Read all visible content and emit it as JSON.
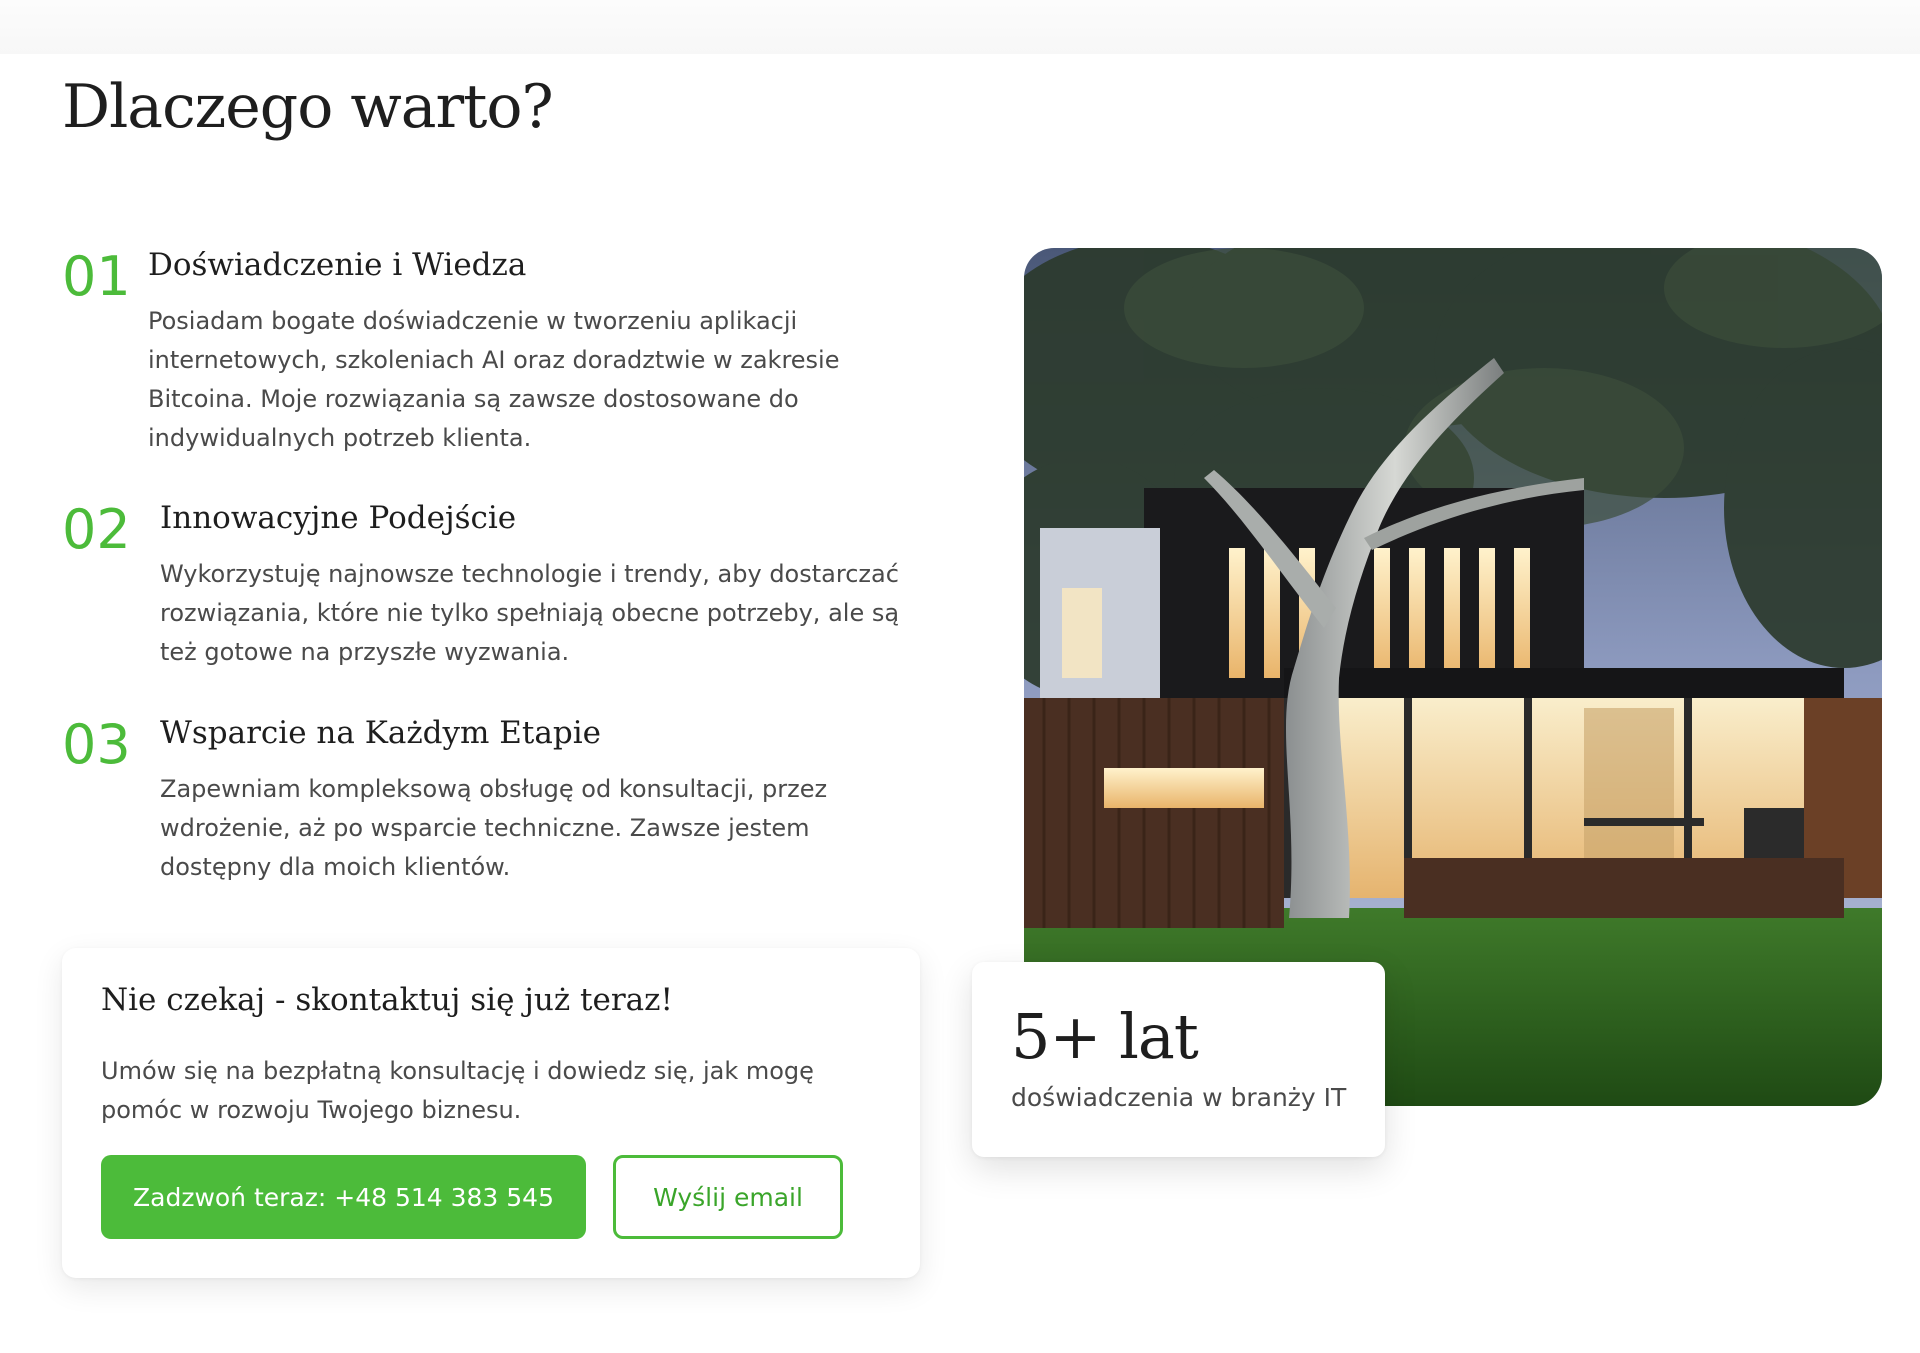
{
  "section": {
    "title": "Dlaczego warto?"
  },
  "features": [
    {
      "number": "01",
      "title": "Doświadczenie i Wiedza",
      "lines": [
        "Posiadam bogate doświadczenie w tworzeniu aplikacji",
        "internetowych, szkoleniach AI oraz doradztwie w zakresie",
        "Bitcoina. Moje rozwiązania są zawsze dostosowane do",
        "indywidualnych potrzeb klienta."
      ]
    },
    {
      "number": "02",
      "title": "Innowacyjne Podejście",
      "lines": [
        "Wykorzystuję najnowsze technologie i trendy, aby dostarczać",
        "rozwiązania, które nie tylko spełniają obecne potrzeby, ale są",
        "też gotowe na przyszłe wyzwania."
      ]
    },
    {
      "number": "03",
      "title": "Wsparcie na Każdym Etapie",
      "lines": [
        "Zapewniam kompleksową obsługę od konsultacji, przez",
        "wdrożenie, aż po wsparcie techniczne. Zawsze jestem",
        "dostępny dla moich klientów."
      ]
    }
  ],
  "cta": {
    "title": "Nie czekaj - skontaktuj się już teraz!",
    "lines": [
      "Umów się na bezpłatną konsultację i dowiedz się, jak mogę",
      "pomóc w rozwoju Twojego biznesu."
    ],
    "call_button": "Zadzwoń teraz: +48 514 383 545",
    "email_button": "Wyślij email"
  },
  "stat": {
    "value": "5+ lat",
    "label": "doświadczenia w branży IT"
  },
  "colors": {
    "accent": "#4cbb3a",
    "heading": "#1e1e1e",
    "body_text": "#4a4a4a"
  }
}
